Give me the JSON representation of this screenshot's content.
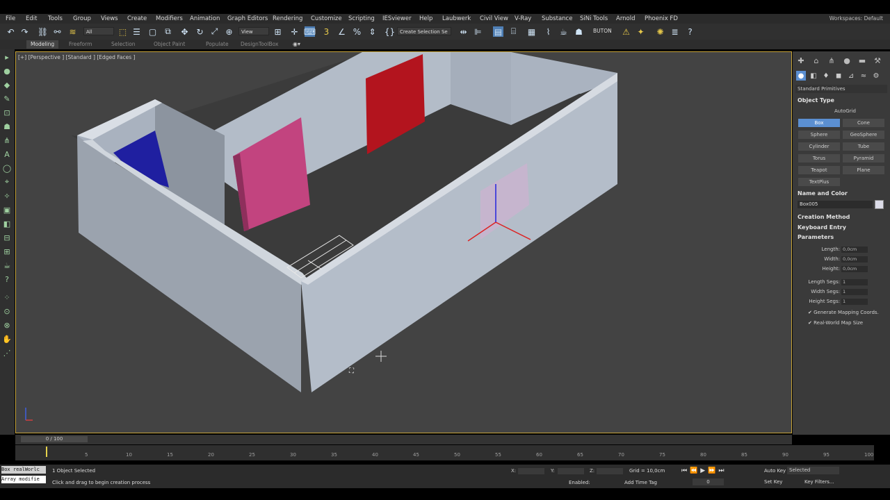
{
  "menu": [
    "File",
    "Edit",
    "Tools",
    "Group",
    "Views",
    "Create",
    "Modifiers",
    "Animation",
    "Graph Editors",
    "Rendering",
    "Customize",
    "Scripting",
    "IESviewer",
    "Help",
    "Laubwerk",
    "Civil View",
    "V-Ray",
    "Substance",
    "SiNi Tools",
    "Arnold",
    "Phoenix FD"
  ],
  "workspace": "Workspaces: Default",
  "toolbar": {
    "filter_combo": "All",
    "view_combo": "View",
    "selection_set": "Create Selection Se",
    "buton_label": "BUTON"
  },
  "ribbon": [
    "Modeling",
    "Freeform",
    "Selection",
    "Object Paint",
    "Populate",
    "DesignToolBox"
  ],
  "viewport": {
    "label": "[+] [Perspective ] [Standard ] [Edged Faces ]",
    "colors": {
      "bg": "#434343",
      "wall": "#b8c0cc",
      "floor": "#3d3d3d",
      "pink": "#c2447f",
      "red": "#b3141e",
      "blue": "#1e1e9e"
    }
  },
  "command_panel": {
    "category": "Standard Primitives",
    "object_type_title": "Object Type",
    "autogrid": "AutoGrid",
    "buttons": [
      "Box",
      "Cone",
      "Sphere",
      "GeoSphere",
      "Cylinder",
      "Tube",
      "Torus",
      "Pyramid",
      "Teapot",
      "Plane",
      "TextPlus"
    ],
    "name_color_title": "Name and Color",
    "object_name": "Box005",
    "creation_method_title": "Creation Method",
    "keyboard_entry_title": "Keyboard Entry",
    "parameters_title": "Parameters",
    "params": [
      {
        "label": "Length:",
        "value": "0,0cm"
      },
      {
        "label": "Width:",
        "value": "0,0cm"
      },
      {
        "label": "Height:",
        "value": "0,0cm"
      },
      {
        "label": "Length Segs:",
        "value": "1"
      },
      {
        "label": "Width Segs:",
        "value": "1"
      },
      {
        "label": "Height Segs:",
        "value": "1"
      }
    ],
    "generate_mapping": "Generate Mapping Coords.",
    "real_world": "Real-World Map Size"
  },
  "timeline": {
    "frame": "0 / 100",
    "ticks": [
      "5",
      "10",
      "15",
      "20",
      "25",
      "30",
      "35",
      "40",
      "45",
      "50",
      "55",
      "60",
      "65",
      "70",
      "75",
      "80",
      "85",
      "90",
      "95",
      "100"
    ]
  },
  "status": {
    "script1": "Box realWorlc",
    "script2": "Array modifie",
    "selected": "1 Object Selected",
    "prompt": "Click and drag to begin creation process",
    "x_label": "X:",
    "y_label": "Y:",
    "z_label": "Z:",
    "grid": "Grid = 10,0cm",
    "enabled": "Enabled:",
    "add_time_tag": "Add Time Tag",
    "auto_key": "Auto Key",
    "set_key": "Set Key",
    "selected_combo": "Selected",
    "key_filters": "Key Filters...",
    "frame_value": "0"
  }
}
